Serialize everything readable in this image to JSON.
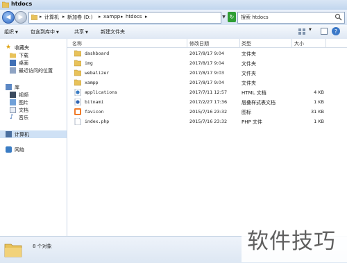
{
  "window": {
    "title": "htdocs"
  },
  "address": {
    "crumbs": [
      "计算机",
      "新加卷 (D:)",
      "xampp",
      "htdocs"
    ],
    "search_placeholder": "搜索 htdocs"
  },
  "toolbar": {
    "organize": "组织",
    "include_library": "包含到库中",
    "share": "共享",
    "new_folder": "新建文件夹"
  },
  "nav": {
    "favorites": "收藏夹",
    "downloads": "下载",
    "desktop": "桌面",
    "recent": "最近访问的位置",
    "libraries": "库",
    "videos": "视频",
    "pictures": "图片",
    "documents": "文档",
    "music": "音乐",
    "computer": "计算机",
    "network": "网络"
  },
  "columns": {
    "name": "名称",
    "date": "修改日期",
    "type": "类型",
    "size": "大小"
  },
  "files": [
    {
      "name": "dashboard",
      "date": "2017/8/17 9:04",
      "type": "文件夹",
      "size": "",
      "icon": "folder-icon"
    },
    {
      "name": "img",
      "date": "2017/8/17 9:04",
      "type": "文件夹",
      "size": "",
      "icon": "folder-icon"
    },
    {
      "name": "webalizer",
      "date": "2017/8/17 9:03",
      "type": "文件夹",
      "size": "",
      "icon": "folder-icon"
    },
    {
      "name": "xampp",
      "date": "2017/8/17 9:04",
      "type": "文件夹",
      "size": "",
      "icon": "folder-icon"
    },
    {
      "name": "applications",
      "date": "2017/7/11 12:57",
      "type": "HTML 文档",
      "size": "4 KB",
      "icon": "html-file-icon"
    },
    {
      "name": "bitnami",
      "date": "2017/2/27 17:36",
      "type": "层叠样式表文档",
      "size": "1 KB",
      "icon": "css-file-icon"
    },
    {
      "name": "favicon",
      "date": "2015/7/16 23:32",
      "type": "图标",
      "size": "31 KB",
      "icon": "ico-file-icon"
    },
    {
      "name": "index.php",
      "date": "2015/7/16 23:32",
      "type": "PHP 文件",
      "size": "1 KB",
      "icon": "php-file-icon"
    }
  ],
  "details": {
    "item_count": "8 个对象"
  },
  "watermark": {
    "text": "软件技巧"
  },
  "colors": {
    "folder": "#e8c25a",
    "selection": "#cfe1f5",
    "accent": "#2d69c5"
  }
}
